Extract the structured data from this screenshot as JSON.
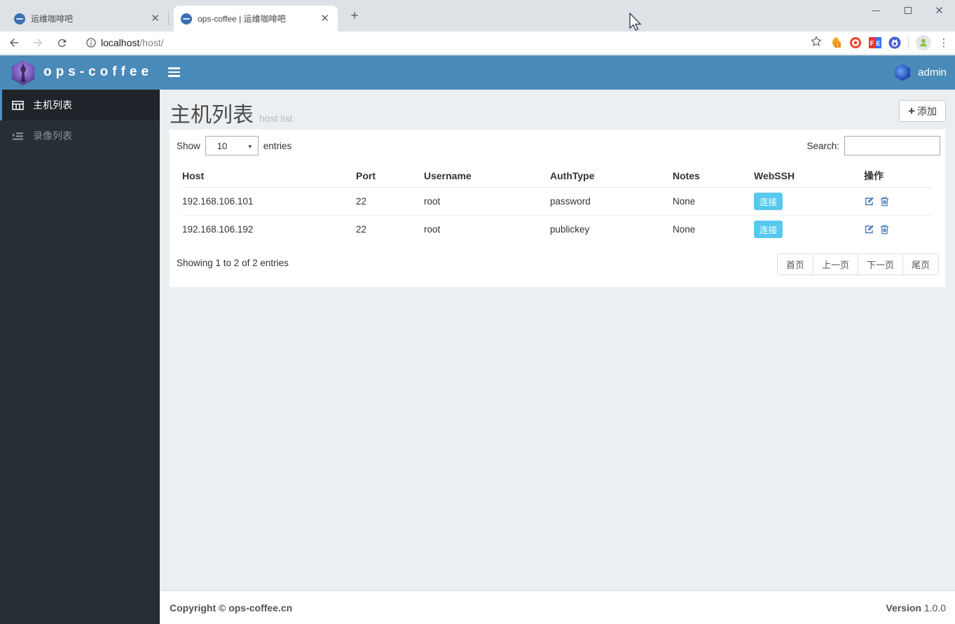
{
  "browser": {
    "tabs": [
      {
        "title": "运维咖啡吧"
      },
      {
        "title": "ops-coffee | 运维咖啡吧"
      }
    ],
    "url": {
      "host": "localhost",
      "path": "/host/"
    }
  },
  "header": {
    "brand": "ops-coffee",
    "user": "admin"
  },
  "sidebar": {
    "items": [
      {
        "label": "主机列表"
      },
      {
        "label": "录像列表"
      }
    ]
  },
  "page": {
    "title": "主机列表",
    "subtitle": "host list",
    "add_label": "添加",
    "add_plus": "+"
  },
  "controls": {
    "show_label": "Show",
    "page_size": "10",
    "entries_label": "entries",
    "search_label": "Search:",
    "select_arrow": "▼"
  },
  "table": {
    "columns": [
      "Host",
      "Port",
      "Username",
      "AuthType",
      "Notes",
      "WebSSH",
      "操作"
    ],
    "rows": [
      {
        "host": "192.168.106.101",
        "port": "22",
        "username": "root",
        "authtype": "password",
        "notes": "None",
        "webssh_label": "连接"
      },
      {
        "host": "192.168.106.192",
        "port": "22",
        "username": "root",
        "authtype": "publickey",
        "notes": "None",
        "webssh_label": "连接"
      }
    ],
    "info": "Showing 1 to 2 of 2 entries",
    "pagination": [
      "首页",
      "上一页",
      "下一页",
      "尾页"
    ]
  },
  "footer": {
    "copyright": "Copyright © ops-coffee.cn",
    "version_label": "Version",
    "version_value": "1.0.0"
  },
  "colors": {
    "header_blue": "#4a8ab9",
    "sidebar_dark": "#272e36",
    "webssh_cyan": "#59c8ee",
    "action_icon_blue": "#4a7cb8",
    "main_bg": "#eceff2"
  }
}
